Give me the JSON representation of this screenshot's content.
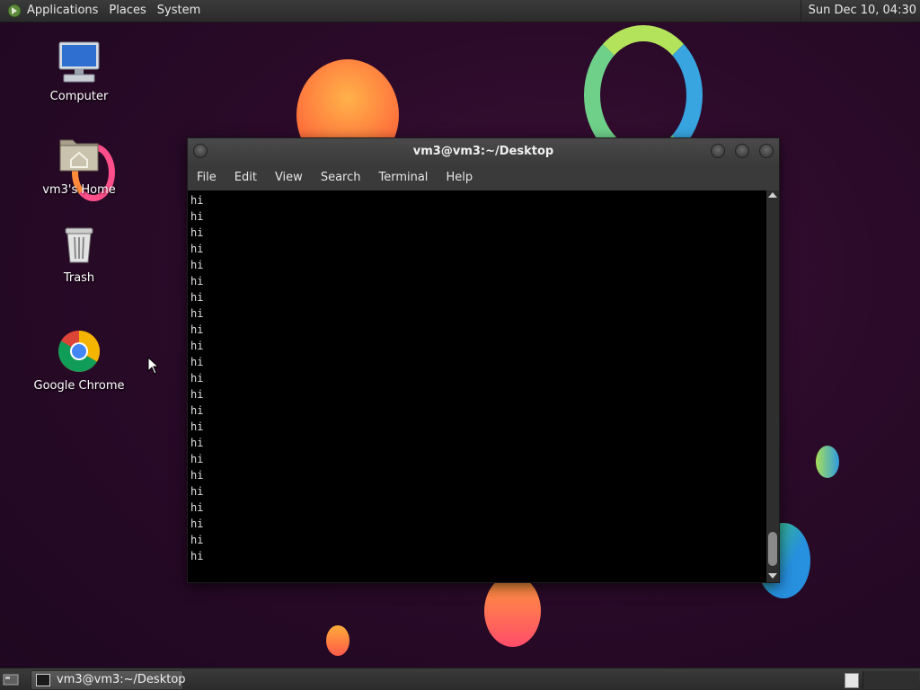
{
  "top_panel": {
    "menus": [
      "Applications",
      "Places",
      "System"
    ],
    "clock": "Sun Dec 10, 04:30",
    "logo_icon": "mate-logo-icon"
  },
  "desktop_icons": [
    {
      "label": "Computer",
      "icon": "computer-icon"
    },
    {
      "label": "vm3's Home",
      "icon": "home-folder-icon"
    },
    {
      "label": "Trash",
      "icon": "trash-icon"
    },
    {
      "label": "Google Chrome",
      "icon": "chrome-icon"
    }
  ],
  "terminal": {
    "title": "vm3@vm3:~/Desktop",
    "menus": [
      "File",
      "Edit",
      "View",
      "Search",
      "Terminal",
      "Help"
    ],
    "output_lines": [
      "hi",
      "hi",
      "hi",
      "hi",
      "hi",
      "hi",
      "hi",
      "hi",
      "hi",
      "hi",
      "hi",
      "hi",
      "hi",
      "hi",
      "hi",
      "hi",
      "hi",
      "hi",
      "hi",
      "hi",
      "hi",
      "hi",
      "hi"
    ]
  },
  "taskbar": {
    "items": [
      {
        "label": "vm3@vm3:~/Desktop",
        "icon": "terminal-icon"
      }
    ]
  },
  "colors": {
    "desktop_bg": "#2a0a28",
    "panel_bg": "#333333",
    "terminal_bg": "#000000",
    "terminal_fg": "#e0e0e0"
  }
}
